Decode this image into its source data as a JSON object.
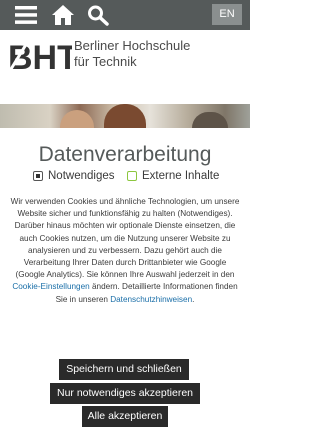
{
  "header": {
    "menu_icon": "hamburger-menu-icon",
    "home_icon": "home-icon",
    "search_icon": "search-icon",
    "language": "EN"
  },
  "logo": {
    "mark_text": "BHT",
    "line1": "Berliner Hochschule",
    "line2": "für Technik"
  },
  "consent": {
    "title": "Datenverarbeitung",
    "option_necessary": "Notwendiges",
    "option_external": "Externe Inhalte",
    "desc_1": "Wir verwenden Cookies und ähnliche Technologien, um unsere Website sicher und funktionsfähig zu halten (Notwendiges). Darüber hinaus möchten wir optionale Dienste einsetzen, die auch Cookies nutzen, um die Nutzung unserer Website zu analysieren und zu verbessern. Dazu gehört auch die Verarbeitung Ihrer Daten durch Drittanbieter wie Google (Google Analytics). Sie können Ihre Auswahl jederzeit in den ",
    "link_cookie_settings": "Cookie-Einstellungen",
    "desc_2": " ändern. Detaillierte Informationen finden Sie in unseren ",
    "link_privacy": "Datenschutzhinweisen",
    "desc_3": ".",
    "btn_save": "Speichern und schließen",
    "btn_necessary_only": "Nur notwendiges akzeptieren",
    "btn_accept_all": "Alle akzeptieren"
  },
  "colors": {
    "header_bg": "#555a5a",
    "link": "#1b6fa8",
    "checkbox_external": "#8cc63f",
    "button_bg": "#2a2a2a"
  }
}
